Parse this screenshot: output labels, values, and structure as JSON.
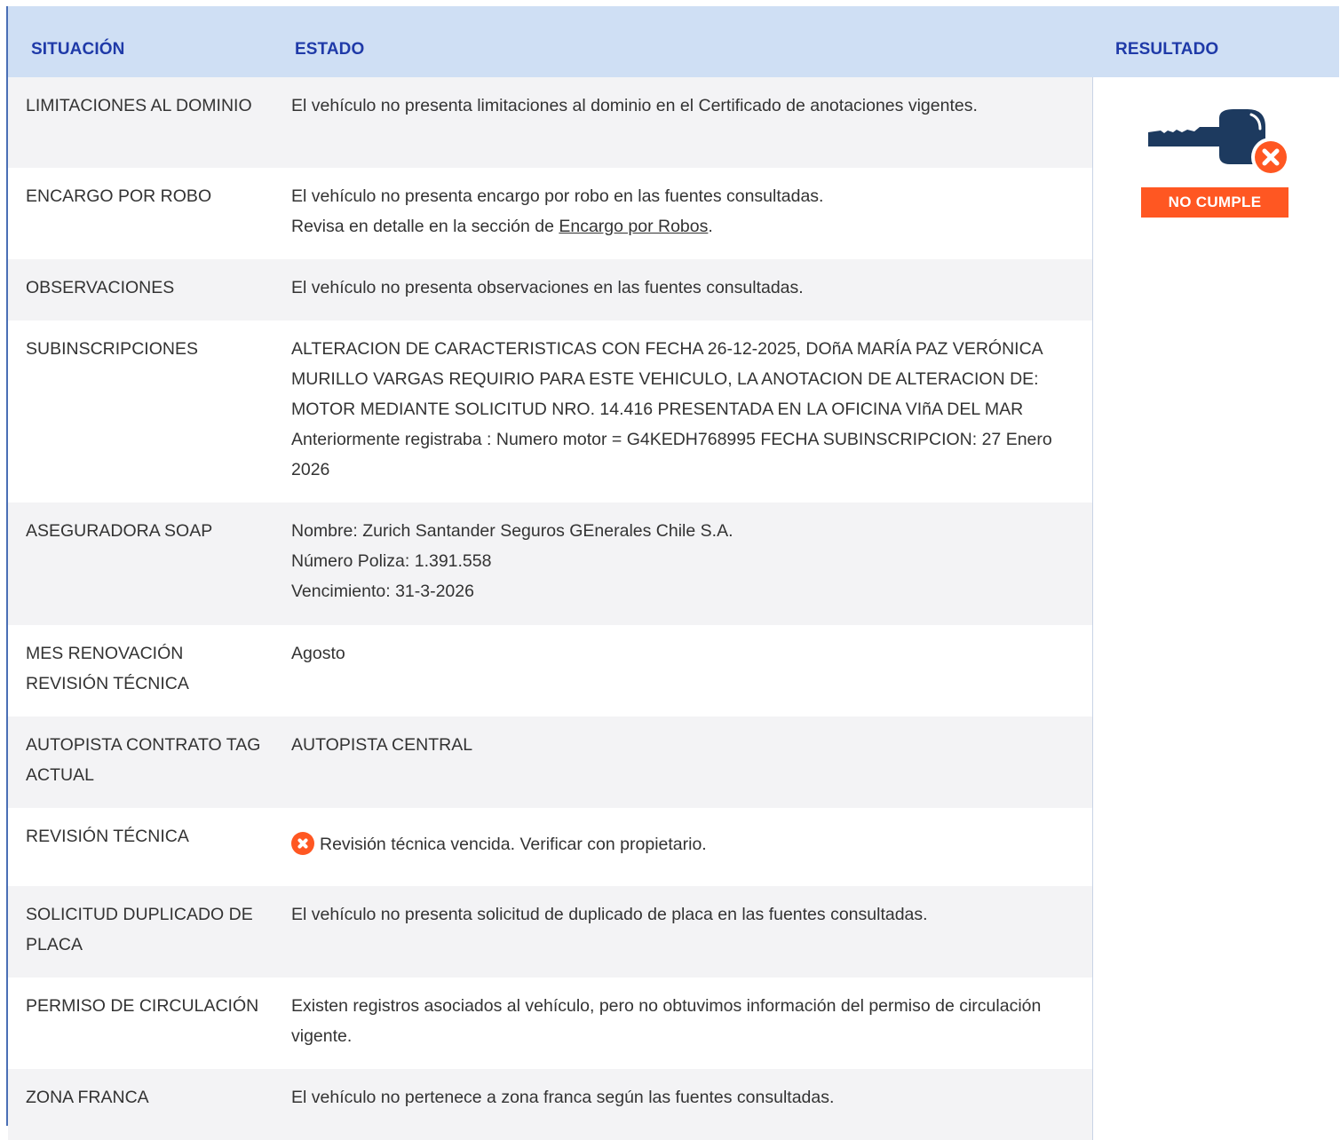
{
  "header": {
    "col_situacion": "SITUACIÓN",
    "col_estado": "ESTADO",
    "col_resultado": "RESULTADO"
  },
  "rows": [
    {
      "situacion": "LIMITACIONES AL DOMINIO",
      "estado": [
        "El vehículo no presenta limitaciones al dominio en el Certificado de anotaciones vigentes."
      ]
    },
    {
      "situacion": "ENCARGO POR ROBO",
      "estado": [
        "El vehículo no presenta encargo por robo en las fuentes consultadas."
      ],
      "link_prefix": "Revisa en detalle en la sección de ",
      "link_text": "Encargo por Robos",
      "link_suffix": "."
    },
    {
      "situacion": "OBSERVACIONES",
      "estado": [
        "El vehículo no presenta observaciones en las fuentes consultadas."
      ]
    },
    {
      "situacion": "SUBINSCRIPCIONES",
      "estado": [
        "ALTERACION DE CARACTERISTICAS CON FECHA 26-12-2025, DOñA MARÍA PAZ VERÓNICA MURILLO VARGAS REQUIRIO PARA ESTE VEHICULO, LA ANOTACION DE ALTERACION DE: MOTOR MEDIANTE SOLICITUD NRO. 14.416 PRESENTADA EN LA OFICINA VIñA DEL MAR Anteriormente registraba : Numero motor = G4KEDH768995 FECHA SUBINSCRIPCION: 27 Enero 2026"
      ]
    },
    {
      "situacion": "ASEGURADORA SOAP",
      "estado": [
        "Nombre: Zurich Santander Seguros GEnerales Chile S.A.",
        "Número Poliza: 1.391.558",
        "Vencimiento: 31-3-2026"
      ]
    },
    {
      "situacion": "MES RENOVACIÓN REVISIÓN TÉCNICA",
      "estado": [
        "Agosto"
      ]
    },
    {
      "situacion": "AUTOPISTA CONTRATO TAG ACTUAL",
      "estado": [
        "AUTOPISTA CENTRAL"
      ]
    },
    {
      "situacion": "REVISIÓN TÉCNICA",
      "estado": [
        "Revisión técnica vencida. Verificar con propietario."
      ],
      "icon": "error-circle-icon"
    },
    {
      "situacion": "SOLICITUD DUPLICADO DE PLACA",
      "estado": [
        "El vehículo no presenta solicitud de duplicado de placa en las fuentes consultadas."
      ]
    },
    {
      "situacion": "PERMISO DE CIRCULACIÓN",
      "estado": [
        "Existen registros asociados al vehículo, pero no obtuvimos información del permiso de circulación vigente."
      ]
    },
    {
      "situacion": "ZONA FRANCA",
      "estado": [
        "El vehículo no pertenece a zona franca según las fuentes consultadas."
      ]
    }
  ],
  "result": {
    "icon": "key-error-icon",
    "badge": "NO CUMPLE",
    "colors": {
      "badge": "#ff5722",
      "key": "#1d3a5f",
      "header_text": "#1f3aa8",
      "header_bg": "#cfdff4",
      "row_gray": "#f3f3f5"
    }
  }
}
